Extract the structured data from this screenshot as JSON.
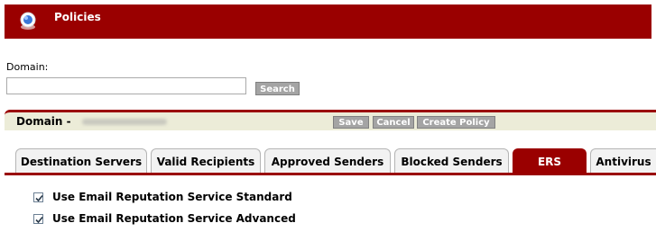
{
  "header": {
    "title": "Policies",
    "icon": "globe-icon"
  },
  "search": {
    "label": "Domain:",
    "value": "",
    "placeholder": "",
    "button_label": "Search"
  },
  "panel": {
    "domain_label": "Domain -",
    "actions": {
      "save": "Save",
      "cancel": "Cancel",
      "create_policy": "Create Policy"
    }
  },
  "tabs": [
    {
      "label": "Destination Servers",
      "active": false
    },
    {
      "label": "Valid Recipients",
      "active": false
    },
    {
      "label": "Approved Senders",
      "active": false
    },
    {
      "label": "Blocked Senders",
      "active": false
    },
    {
      "label": "ERS",
      "active": true
    },
    {
      "label": "Antivirus",
      "active": false
    }
  ],
  "options": [
    {
      "label": "Use Email Reputation Service Standard",
      "checked": true
    },
    {
      "label": "Use Email Reputation Service Advanced",
      "checked": true
    }
  ],
  "colors": {
    "accent": "#9a0000",
    "panel_bg": "#ececd8",
    "button_bg": "#a4a4a4"
  }
}
